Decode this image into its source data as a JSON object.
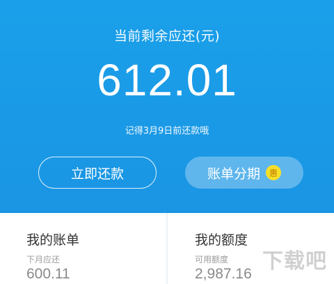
{
  "hero": {
    "title": "当前剩余应还(元)",
    "amount": "612.01",
    "due_note": "记得3月9日前还款哦",
    "repay_label": "立即还款",
    "installment_label": "账单分期",
    "installment_badge": "惠"
  },
  "cards": {
    "bill": {
      "title": "我的账单",
      "subtitle": "下月应还",
      "value": "600.11"
    },
    "quota": {
      "title": "我的额度",
      "subtitle": "可用额度",
      "value": "2,987.16"
    }
  },
  "watermark": "下载吧",
  "colors": {
    "primary_blue": "#1a9be6",
    "badge_yellow": "#f6e02a",
    "card_bg": "#ffffff"
  }
}
